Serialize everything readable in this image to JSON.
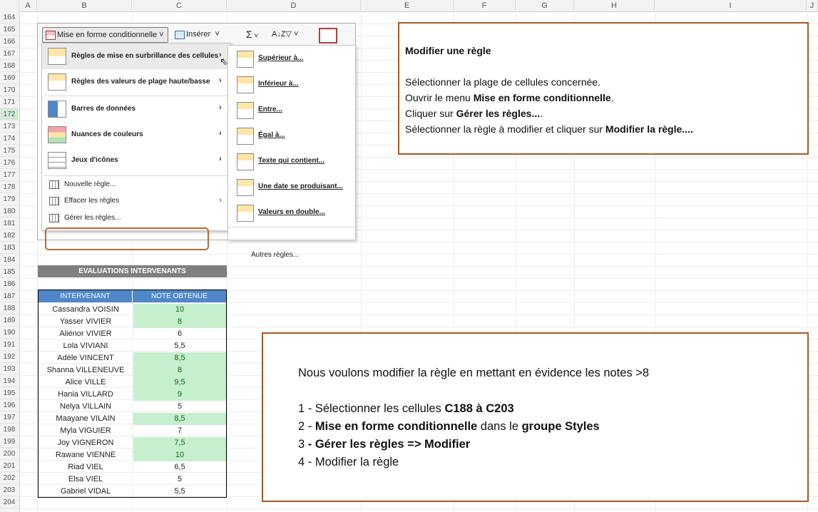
{
  "columns": [
    "A",
    "B",
    "C",
    "D",
    "E",
    "F",
    "G",
    "H",
    "I",
    "J"
  ],
  "rows": [
    "164",
    "165",
    "166",
    "167",
    "168",
    "169",
    "170",
    "171",
    "172",
    "173",
    "174",
    "175",
    "176",
    "177",
    "178",
    "179",
    "180",
    "181",
    "182",
    "183",
    "184",
    "185",
    "186",
    "187",
    "188",
    "189",
    "190",
    "191",
    "192",
    "193",
    "194",
    "195",
    "196",
    "197",
    "198",
    "199",
    "200",
    "201",
    "202",
    "203",
    "204"
  ],
  "ribbon": {
    "conditional_formatting": "Mise en forme conditionnelle",
    "insert": "Insérer",
    "sum_icon": "Σ",
    "sort_icon": "A↓Z▽",
    "menu": {
      "highlight_rules": "Règles de mise en surbrillance des cellules",
      "top_bottom_rules": "Règles des valeurs de plage haute/basse",
      "data_bars": "Barres de données",
      "color_scales": "Nuances de couleurs",
      "icon_sets": "Jeux d'icônes",
      "new_rule": "Nouvelle règle...",
      "clear_rules": "Effacer les règles",
      "manage_rules": "Gérer les règles..."
    },
    "submenu": {
      "greater": "Supérieur à...",
      "less": "Inférieur à...",
      "between": "Entre...",
      "equal": "Égal à...",
      "text_contains": "Texte qui contient...",
      "date_occurring": "Une date se produisant...",
      "duplicates": "Valeurs en double...",
      "more_rules": "Autres règles..."
    }
  },
  "table": {
    "title": "EVALUATIONS INTERVENANTS",
    "headers": [
      "INTERVENANT",
      "NOTE OBTENUE"
    ],
    "rows": [
      {
        "name": "Cassandra VOISIN",
        "note": "10"
      },
      {
        "name": "Yasser VIVIER",
        "note": "8"
      },
      {
        "name": "Aliénor VIVIER",
        "note": "6"
      },
      {
        "name": "Lola VIVIANI",
        "note": "5,5"
      },
      {
        "name": "Adèle VINCENT",
        "note": "8,5"
      },
      {
        "name": "Shanna VILLENEUVE",
        "note": "8"
      },
      {
        "name": "Alice VILLE",
        "note": "9,5"
      },
      {
        "name": "Hania VILLARD",
        "note": "9"
      },
      {
        "name": "Nelya VILLAIN",
        "note": "5"
      },
      {
        "name": "Maayane VILAIN",
        "note": "8,5"
      },
      {
        "name": "Myla VIGUIER",
        "note": "7"
      },
      {
        "name": "Joy VIGNERON",
        "note": "7,5"
      },
      {
        "name": "Rawane VIENNE",
        "note": "10"
      },
      {
        "name": "Riad VIEL",
        "note": "6,5"
      },
      {
        "name": "Elsa VIEL",
        "note": "5"
      },
      {
        "name": "Gabriel VIDAL",
        "note": "5,5"
      }
    ],
    "highlight_color": "#c6efce"
  },
  "box1": {
    "title": "Modifier une règle",
    "line1": "Sélectionner la plage de cellules concernée.",
    "line2_pre": "Ouvrir le menu ",
    "line2_bold": "Mise en forme conditionnelle",
    "line2_post": ".",
    "line3_pre": "Cliquer sur ",
    "line3_bold": "Gérer les règles...",
    "line3_post": ".",
    "line4_pre": "Sélectionner la règle à modifier et cliquer sur ",
    "line4_bold": "Modifier la règle...."
  },
  "box2": {
    "intro": "Nous voulons modifier la règle en mettant en évidence les notes >8",
    "s1_pre": "1 - Sélectionner les cellules ",
    "s1_bold": "C188 à C203",
    "s2_pre": "2 - ",
    "s2_bold": "Mise en forme conditionnelle",
    "s2_mid": " dans le ",
    "s2_bold2": "groupe Styles",
    "s3_pre": "3 ",
    "s3_bold": "- Gérer les règles => Modifier",
    "s4": "4 - Modifier la règle"
  }
}
